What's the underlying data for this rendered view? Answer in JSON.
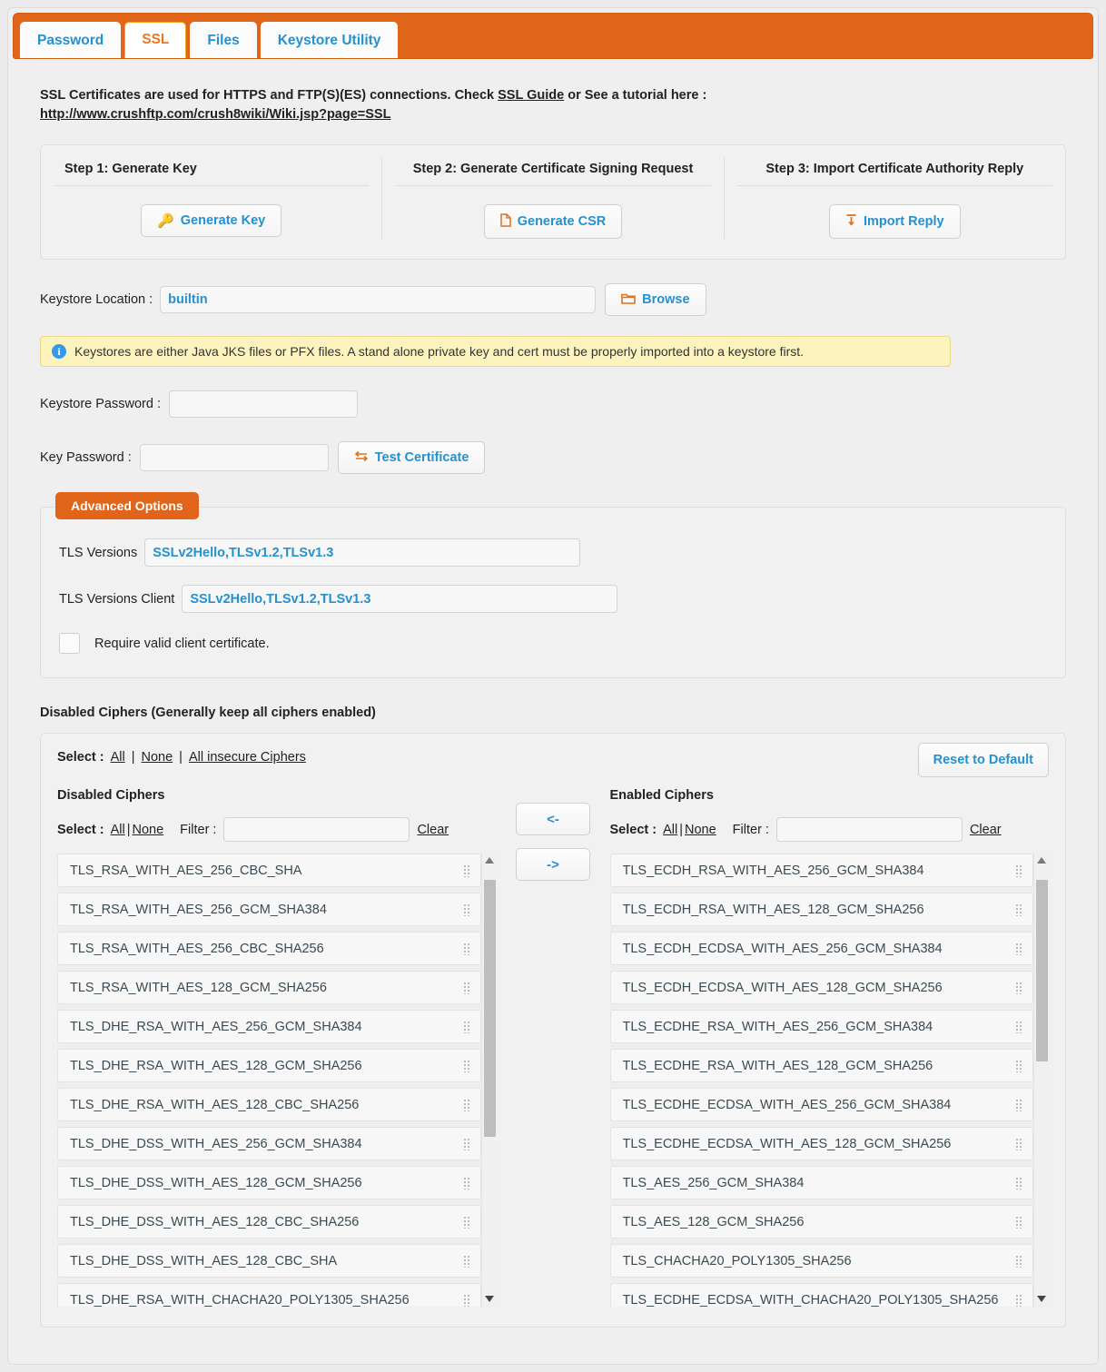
{
  "tabs": [
    {
      "label": "Password",
      "active": false
    },
    {
      "label": "SSL",
      "active": true
    },
    {
      "label": "Files",
      "active": false
    },
    {
      "label": "Keystore Utility",
      "active": false
    }
  ],
  "intro": {
    "part1": "SSL Certificates are used for HTTPS and FTP(S)(ES) connections. Check ",
    "guide_link": "SSL Guide",
    "part2": " or See a tutorial here :",
    "url": "http://www.crushftp.com/crush8wiki/Wiki.jsp?page=SSL"
  },
  "steps": [
    {
      "title": "Step 1: Generate Key",
      "button": "Generate Key",
      "icon": "key-icon"
    },
    {
      "title": "Step 2: Generate Certificate Signing Request",
      "button": "Generate CSR",
      "icon": "document-icon"
    },
    {
      "title": "Step 3: Import Certificate Authority Reply",
      "button": "Import Reply",
      "icon": "import-icon"
    }
  ],
  "keystore": {
    "location_label": "Keystore Location :",
    "location_value": "builtin",
    "browse_label": "Browse",
    "browse_icon": "folder-icon",
    "notice": "Keystores are either Java JKS files or PFX files. A stand alone private key and cert must be properly imported into a keystore first.",
    "notice_icon": "info-icon",
    "password_label": "Keystore Password :",
    "password_value": "",
    "key_password_label": "Key Password :",
    "key_password_value": "",
    "test_label": "Test Certificate",
    "test_icon": "swap-arrows-icon"
  },
  "advanced": {
    "tab_label": "Advanced Options",
    "tls_label": "TLS Versions",
    "tls_value": "SSLv2Hello,TLSv1.2,TLSv1.3",
    "tls_client_label": "TLS Versions Client",
    "tls_client_value": "SSLv2Hello,TLSv1.2,TLSv1.3",
    "require_cert_label": "Require valid client certificate.",
    "require_cert_checked": false
  },
  "ciphers": {
    "section_title": "Disabled Ciphers (Generally keep all ciphers enabled)",
    "select_label": "Select :",
    "select_all": "All",
    "select_none": "None",
    "select_insecure": "All insecure Ciphers",
    "sep": "|",
    "reset_label": "Reset to Default",
    "move_left": "<-",
    "move_right": "->",
    "left": {
      "title": "Disabled Ciphers",
      "select_label": "Select :",
      "all": "All",
      "none": "None",
      "sep": "|",
      "filter_label": "Filter :",
      "filter_value": "",
      "clear_label": "Clear",
      "items": [
        "TLS_RSA_WITH_AES_256_CBC_SHA",
        "TLS_RSA_WITH_AES_256_GCM_SHA384",
        "TLS_RSA_WITH_AES_256_CBC_SHA256",
        "TLS_RSA_WITH_AES_128_GCM_SHA256",
        "TLS_DHE_RSA_WITH_AES_256_GCM_SHA384",
        "TLS_DHE_RSA_WITH_AES_128_GCM_SHA256",
        "TLS_DHE_RSA_WITH_AES_128_CBC_SHA256",
        "TLS_DHE_DSS_WITH_AES_256_GCM_SHA384",
        "TLS_DHE_DSS_WITH_AES_128_GCM_SHA256",
        "TLS_DHE_DSS_WITH_AES_128_CBC_SHA256",
        "TLS_DHE_DSS_WITH_AES_128_CBC_SHA",
        "TLS_DHE_RSA_WITH_CHACHA20_POLY1305_SHA256"
      ]
    },
    "right": {
      "title": "Enabled Ciphers",
      "select_label": "Select :",
      "all": "All",
      "none": "None",
      "sep": "|",
      "filter_label": "Filter :",
      "filter_value": "",
      "clear_label": "Clear",
      "items": [
        "TLS_ECDH_RSA_WITH_AES_256_GCM_SHA384",
        "TLS_ECDH_RSA_WITH_AES_128_GCM_SHA256",
        "TLS_ECDH_ECDSA_WITH_AES_256_GCM_SHA384",
        "TLS_ECDH_ECDSA_WITH_AES_128_GCM_SHA256",
        "TLS_ECDHE_RSA_WITH_AES_256_GCM_SHA384",
        "TLS_ECDHE_RSA_WITH_AES_128_GCM_SHA256",
        "TLS_ECDHE_ECDSA_WITH_AES_256_GCM_SHA384",
        "TLS_ECDHE_ECDSA_WITH_AES_128_GCM_SHA256",
        "TLS_AES_256_GCM_SHA384",
        "TLS_AES_128_GCM_SHA256",
        "TLS_CHACHA20_POLY1305_SHA256",
        "TLS_ECDHE_ECDSA_WITH_CHACHA20_POLY1305_SHA256"
      ]
    }
  },
  "colors": {
    "accent_orange": "#e0641a",
    "link_blue": "#2591cf",
    "notice_yellow": "#fdf3bf",
    "panel_gray": "#f1f1f1"
  }
}
